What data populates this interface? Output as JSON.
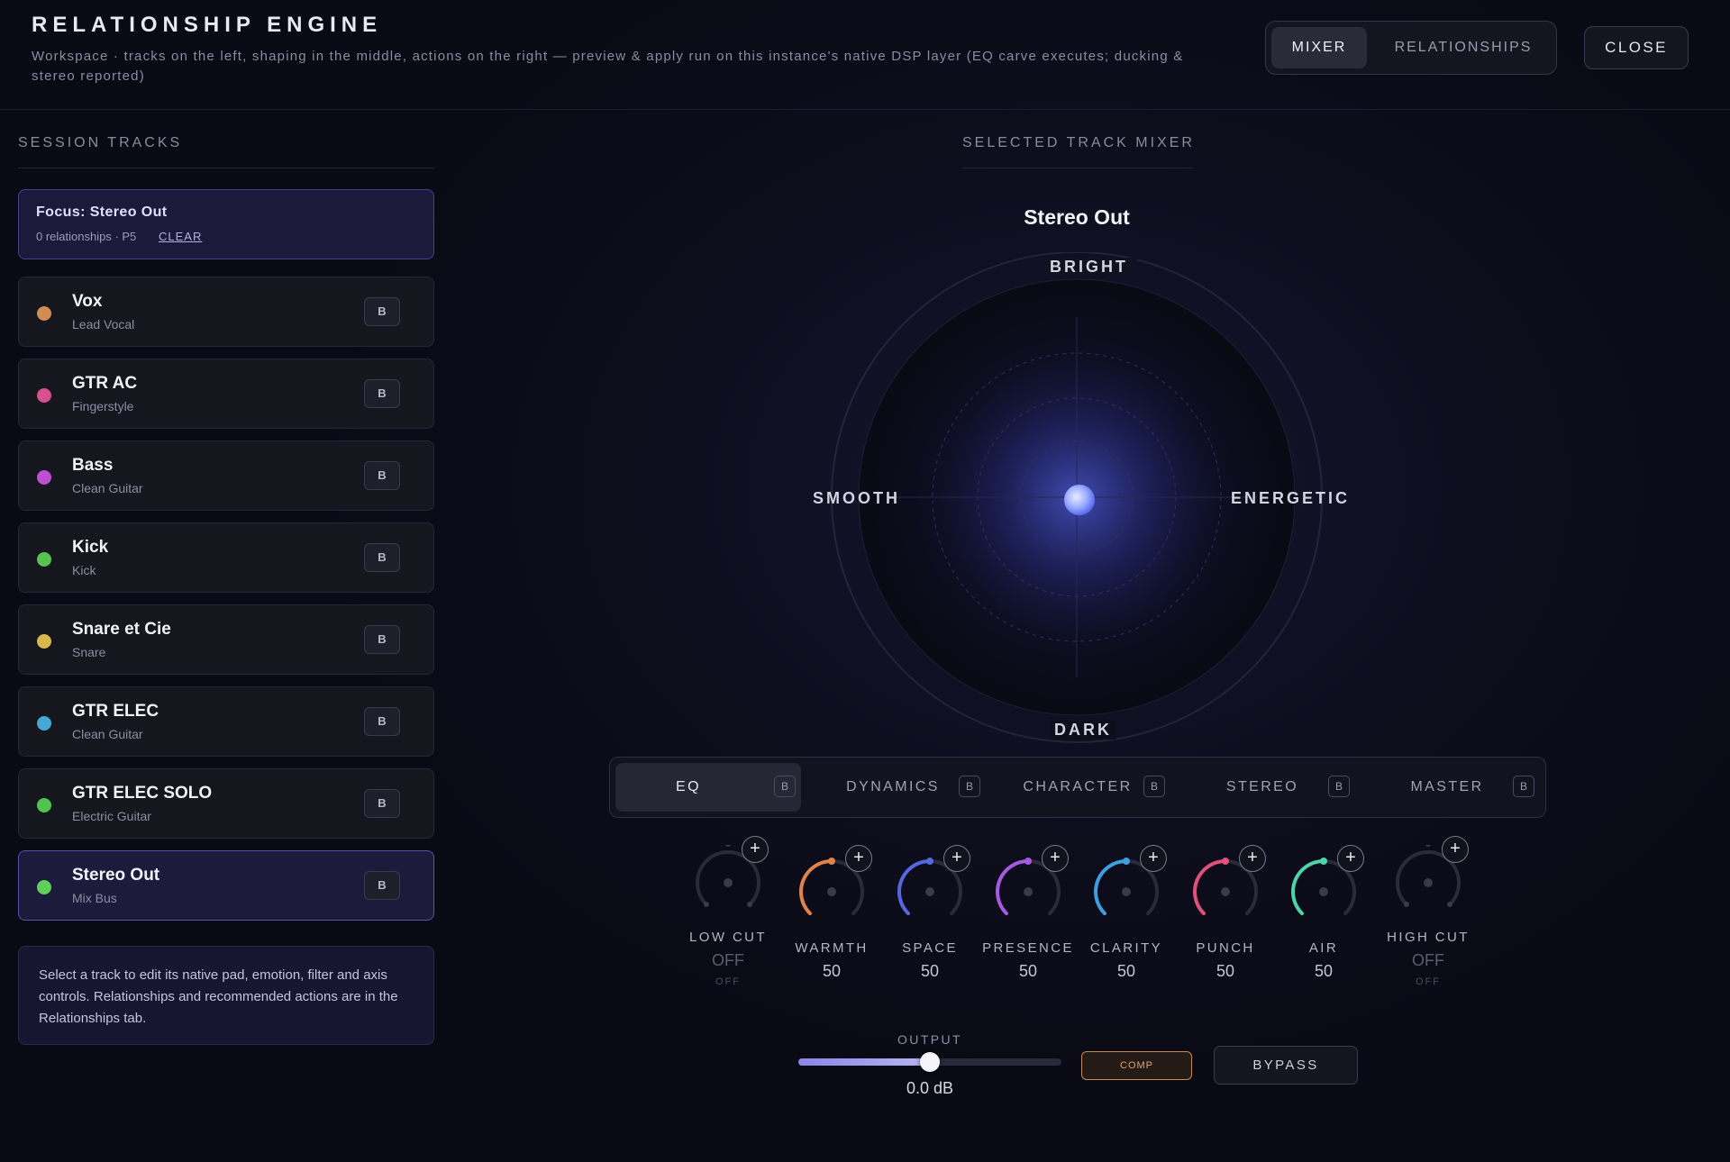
{
  "header": {
    "title": "RELATIONSHIP ENGINE",
    "subtitle": "Workspace · tracks on the left, shaping in the middle, actions on the right — preview & apply run on this instance's native DSP layer (EQ carve executes; ducking & stereo reported)",
    "tabs": [
      {
        "label": "MIXER",
        "active": true
      },
      {
        "label": "RELATIONSHIPS",
        "active": false
      }
    ],
    "close_label": "CLOSE"
  },
  "tracks_panel": {
    "title": "SESSION TRACKS",
    "focus": {
      "title": "Focus: Stereo Out",
      "meta": "0 relationships · P5",
      "clear_label": "CLEAR"
    },
    "tracks": [
      {
        "name": "Vox",
        "sub": "Lead Vocal",
        "color": "#d08c55",
        "b": "B"
      },
      {
        "name": "GTR AC",
        "sub": "Fingerstyle",
        "color": "#d8508e",
        "b": "B"
      },
      {
        "name": "Bass",
        "sub": "Clean Guitar",
        "color": "#bd4fd0",
        "b": "B"
      },
      {
        "name": "Kick",
        "sub": "Kick",
        "color": "#55c44f",
        "b": "B"
      },
      {
        "name": "Snare et Cie",
        "sub": "Snare",
        "color": "#d6b84f",
        "b": "B"
      },
      {
        "name": "GTR ELEC",
        "sub": "Clean Guitar",
        "color": "#46a8d4",
        "b": "B"
      },
      {
        "name": "GTR ELEC SOLO",
        "sub": "Electric Guitar",
        "color": "#4fc44f",
        "b": "B"
      },
      {
        "name": "Stereo Out",
        "sub": "Mix Bus",
        "color": "#5fcf5a",
        "b": "B",
        "selected": true
      }
    ],
    "info": "Select a track to edit its native pad, emotion, filter and axis controls. Relationships and recommended actions are in the Relationships tab."
  },
  "mixer": {
    "title": "SELECTED TRACK MIXER",
    "track_name": "Stereo Out",
    "pad": {
      "top": "BRIGHT",
      "bottom": "DARK",
      "left": "SMOOTH",
      "right": "ENERGETIC",
      "x": 0.0,
      "y": 0.0
    },
    "module_tabs": [
      {
        "label": "EQ",
        "b": "B",
        "active": true
      },
      {
        "label": "DYNAMICS",
        "b": "B"
      },
      {
        "label": "CHARACTER",
        "b": "B"
      },
      {
        "label": "STEREO",
        "b": "B"
      },
      {
        "label": "MASTER",
        "b": "B"
      }
    ],
    "knobs": [
      {
        "label": "LOW CUT",
        "value": "OFF",
        "sub": "OFF",
        "percent": 0,
        "color": "#5a5a6e",
        "off": true
      },
      {
        "label": "WARMTH",
        "value": "50",
        "percent": 50,
        "color": "#e0834a"
      },
      {
        "label": "SPACE",
        "value": "50",
        "percent": 50,
        "color": "#5466e0"
      },
      {
        "label": "PRESENCE",
        "value": "50",
        "percent": 50,
        "color": "#a65ae0"
      },
      {
        "label": "CLARITY",
        "value": "50",
        "percent": 50,
        "color": "#3f9ee0"
      },
      {
        "label": "PUNCH",
        "value": "50",
        "percent": 50,
        "color": "#e0507a"
      },
      {
        "label": "AIR",
        "value": "50",
        "percent": 50,
        "color": "#4fd4a8"
      },
      {
        "label": "HIGH CUT",
        "value": "OFF",
        "sub": "OFF",
        "percent": 0,
        "color": "#5a5a6e",
        "off": true
      }
    ],
    "output": {
      "label": "OUTPUT",
      "value": "0.0 dB",
      "fraction": 0.5
    },
    "comp_label": "COMP",
    "bypass_label": "BYPASS"
  }
}
